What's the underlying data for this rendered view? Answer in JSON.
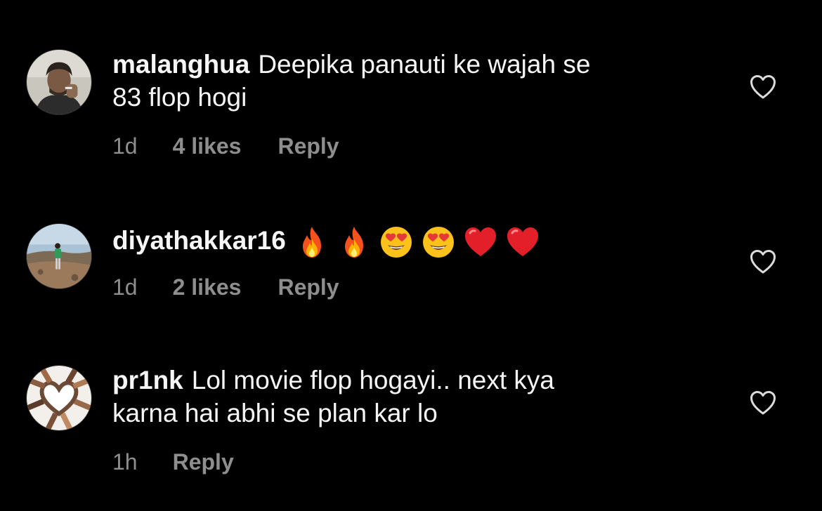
{
  "comments": [
    {
      "username": "malanghua",
      "text_line1": "Deepika panauti ke wajah se",
      "text_line2": "83 flop hogi",
      "time": "1d",
      "likes": "4 likes",
      "reply": "Reply",
      "avatar": "man-smoking-avatar",
      "like_icon": "heart-outline-icon"
    },
    {
      "username": "diyathakkar16",
      "emojis": [
        "fire-emoji",
        "fire-emoji",
        "heart-eyes-emoji",
        "heart-eyes-emoji",
        "red-heart-emoji",
        "red-heart-emoji"
      ],
      "time": "1d",
      "likes": "2 likes",
      "reply": "Reply",
      "avatar": "woman-on-hill-avatar",
      "like_icon": "heart-outline-icon"
    },
    {
      "username": "pr1nk",
      "text_line1": "Lol movie flop hogayi.. next kya",
      "text_line2": "karna hai abhi se plan kar lo",
      "time": "1h",
      "reply": "Reply",
      "avatar": "hands-heart-avatar",
      "like_icon": "heart-outline-icon"
    }
  ],
  "colors": {
    "background": "#000000",
    "primary_text": "#f5f5f5",
    "secondary_text": "#8e8e8e"
  }
}
